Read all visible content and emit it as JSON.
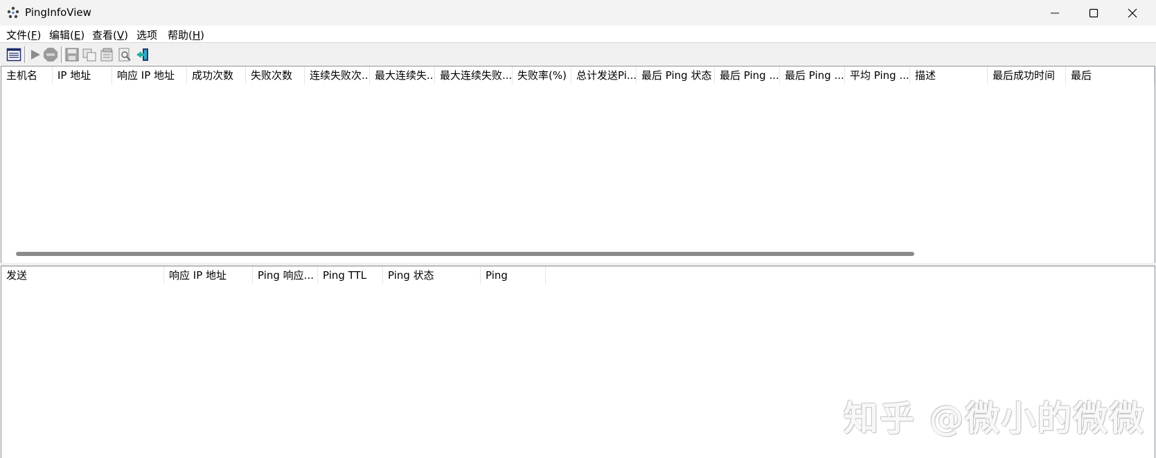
{
  "window": {
    "title": "PingInfoView",
    "icon": "pinginfoview-app-icon",
    "controls": [
      "minimize-icon",
      "maximize-icon",
      "close-icon"
    ]
  },
  "menu": [
    {
      "label": "文件(",
      "acc": "F",
      "end": ")"
    },
    {
      "label": "编辑(",
      "acc": "E",
      "end": ")"
    },
    {
      "label": "查看(",
      "acc": "V",
      "end": ")"
    },
    {
      "label": "选项",
      "acc": "",
      "end": ""
    },
    {
      "label": "帮助(",
      "acc": "H",
      "end": ")"
    }
  ],
  "toolbar": {
    "icons": [
      "options-list-icon",
      "start-ping-icon",
      "stop-icon",
      "save-icon",
      "copy-icon",
      "properties-icon",
      "find-icon",
      "exit-icon"
    ]
  },
  "top_table": {
    "columns": [
      "主机名",
      "IP 地址",
      "响应 IP 地址",
      "成功次数",
      "失败次数",
      "连续失败次...",
      "最大连续失...",
      "最大连续失败...",
      "失败率(%)",
      "总计发送Pi...",
      "最后 Ping 状态",
      "最后 Ping ...",
      "最后 Ping ...",
      "平均 Ping ...",
      "描述",
      "最后成功时间",
      "最后"
    ],
    "rows": []
  },
  "bottom_table": {
    "columns": [
      "发送",
      "响应 IP 地址",
      "Ping 响应...",
      "Ping TTL",
      "Ping 状态",
      "Ping"
    ],
    "rows": []
  },
  "watermark": "知乎 @微小的微微"
}
